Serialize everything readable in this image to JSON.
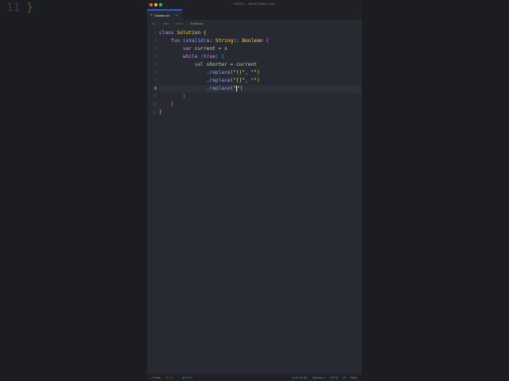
{
  "ghost": {
    "line_number": "11",
    "brace": "}"
  },
  "window": {
    "title": "IcEDD — Visual Studio Code"
  },
  "tab": {
    "icon": "kotlin-file-icon",
    "label": "Solution.kt",
    "close": "×"
  },
  "breadcrumb": {
    "items": [
      "src",
      "main",
      "kotlin"
    ],
    "file": "Solution.kt"
  },
  "editor": {
    "line_numbers": [
      "1",
      "2",
      "3",
      "4",
      "5",
      "6",
      "7",
      "8",
      "9",
      "10",
      "11"
    ],
    "active_line": 8,
    "lines": [
      "class Solution {",
      "    fun isValid(s: String): Boolean {",
      "        var current = s",
      "        while (true) {",
      "            val shorter = current",
      "                .replace(\"()\", \"\")",
      "                .replace(\"[]\", \"\")",
      "                .replace(\"\")",
      "        }",
      "    }",
      "}"
    ]
  },
  "statusbar": {
    "branch": "main",
    "sync": "0 ↓ 1↑",
    "problems": "⊗ 0 ⚠ 0",
    "position": "Ln 8, Col 28",
    "spaces": "Spaces: 4",
    "encoding": "UTF-8",
    "eol": "LF",
    "language": "Kotlin"
  }
}
